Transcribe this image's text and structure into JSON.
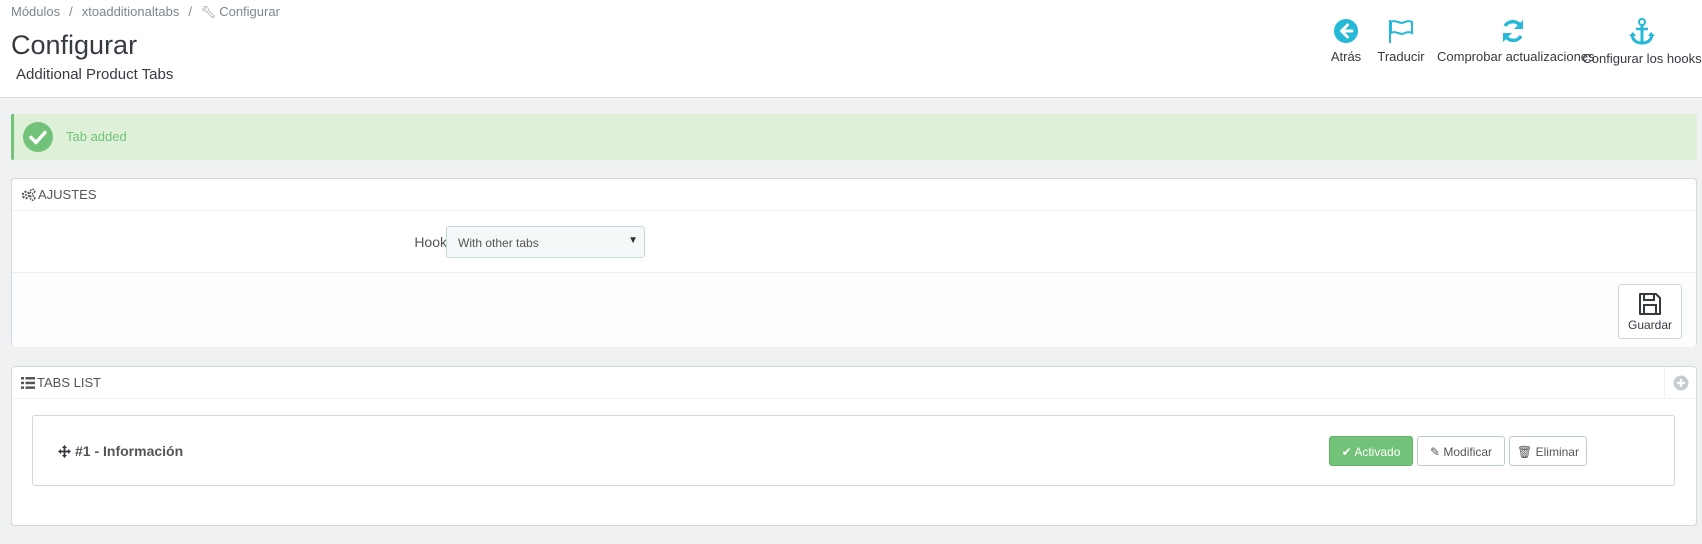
{
  "breadcrumb": {
    "items": [
      "Módulos",
      "xtoadditionaltabs",
      "Configurar"
    ],
    "separator": "/"
  },
  "page": {
    "title": "Configurar",
    "subtitle": "Additional Product Tabs"
  },
  "toolbar": {
    "back_label": "Atrás",
    "translate_label": "Traducir",
    "updates_label": "Comprobar actualizaciones",
    "hooks_label": "Configurar los hooks",
    "icon_color": "#25b9d7"
  },
  "alert": {
    "text": "Tab added",
    "color": "#72c279"
  },
  "settings_panel": {
    "heading": "AJUSTES",
    "hook_label": "Hook",
    "hook_value": "With other tabs",
    "save_label": "Guardar"
  },
  "tabs_panel": {
    "heading": "TABS LIST",
    "items": [
      {
        "name": "#1 - Información",
        "status_label": "Activado",
        "edit_label": "Modificar",
        "delete_label": "Eliminar"
      }
    ]
  }
}
